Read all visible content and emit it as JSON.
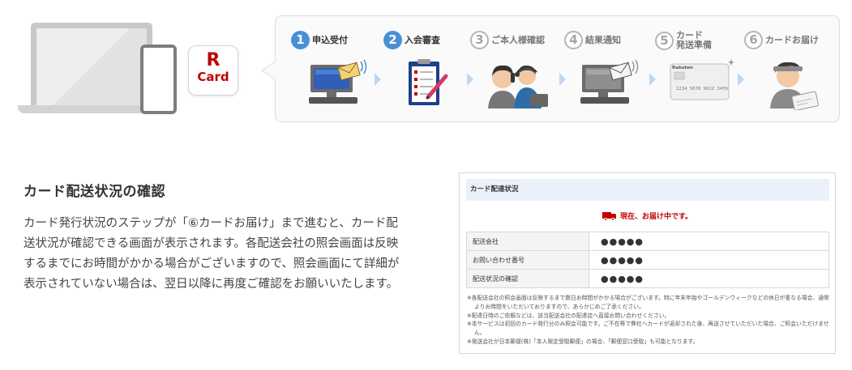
{
  "app_icon": {
    "line1": "R",
    "line2": "Card"
  },
  "steps": [
    {
      "num": "1",
      "label": "申込受付",
      "active": true
    },
    {
      "num": "2",
      "label": "入会審査",
      "active": true
    },
    {
      "num": "3",
      "label": "ご本人様確認",
      "active": false
    },
    {
      "num": "4",
      "label": "結果通知",
      "active": false
    },
    {
      "num": "5",
      "label_line1": "カード",
      "label_line2": "発送準備",
      "active": false
    },
    {
      "num": "6",
      "label": "カードお届け",
      "active": false
    }
  ],
  "card_sample": {
    "brand": "Rakuten",
    "number": "1234 5678 9012 3456"
  },
  "section": {
    "title": "カード配送状況の確認",
    "body": "カード発行状況のステップが「⑥カードお届け」まで進むと、カード配送状況が確認できる画面が表示されます。各配送会社の照会画面は反映するまでにお時間がかかる場合がございますので、照会画面にて詳細が表示されていない場合は、翌日以降に再度ご確認をお願いいたします。"
  },
  "panel": {
    "header": "カード配達状況",
    "status": "現在、お届け中です。",
    "rows": [
      {
        "label": "配送会社",
        "value": "●●●●●"
      },
      {
        "label": "お問い合わせ番号",
        "value": "●●●●●"
      },
      {
        "label": "配送状況の確認",
        "value": "●●●●●"
      }
    ],
    "notes": [
      "※各配送会社の照会画面は反映するまで数日お時間がかかる場合がございます。特に年末年始やゴールデンウィークなどの休日が重なる場合、通常よりお時間をいただいておりますので、あらかじめご了承ください。",
      "※配達日時のご依頼などは、該当配送会社の配達店へ直接お問い合わせください。",
      "※本サービスは初回のカード発行分のみ照会可能です。ご不在等で弊社へカードが返却された後、再送させていただいた場合、ご照会いただけません。",
      "※発送会社が日本郵便(株)「本人限定受取郵便」の場合、「郵便窓口受取」も可能となります。"
    ]
  },
  "colors": {
    "brand_red": "#bf0000",
    "step_active": "#4b8fd6",
    "step_inactive": "#b5b5b5",
    "panel_header_bg": "#eaf1fa"
  }
}
